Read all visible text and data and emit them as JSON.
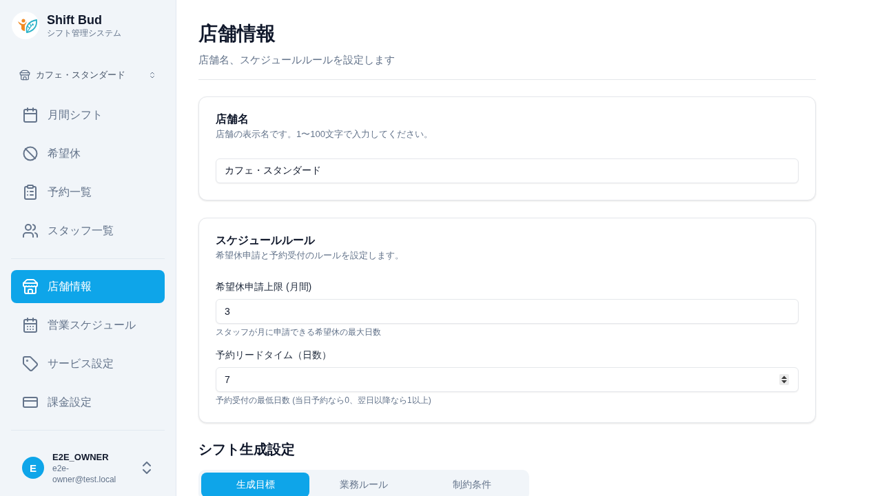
{
  "sidebar": {
    "brand": {
      "name": "Shift Bud",
      "subtitle": "シフト管理システム"
    },
    "store_selector": {
      "value": "カフェ・スタンダード"
    },
    "nav_groups": [
      {
        "items": [
          {
            "label": "月間シフト",
            "selected": false
          },
          {
            "label": "希望休",
            "selected": false
          },
          {
            "label": "予約一覧",
            "selected": false
          },
          {
            "label": "スタッフ一覧",
            "selected": false
          }
        ]
      },
      {
        "items": [
          {
            "label": "店舗情報",
            "selected": true
          },
          {
            "label": "営業スケジュール",
            "selected": false
          },
          {
            "label": "サービス設定",
            "selected": false
          },
          {
            "label": "課金設定",
            "selected": false
          }
        ]
      }
    ],
    "user": {
      "initial": "E",
      "name": "E2E_OWNER",
      "email": "e2e-owner@test.local"
    }
  },
  "page": {
    "title": "店舗情報",
    "subtitle": "店舗名、スケジュールルールを設定します"
  },
  "cards": [
    {
      "title": "店舗名",
      "description": "店舗の表示名です。1〜100文字で入力してください。",
      "fields": [
        {
          "value": "カフェ・スタンダード",
          "stepper": false
        }
      ]
    },
    {
      "title": "スケジュールルール",
      "description": "希望休申請と予約受付のルールを設定します。",
      "fields": [
        {
          "label": "希望休申請上限 (月間)",
          "value": "3",
          "help": "スタッフが月に申請できる希望休の最大日数",
          "stepper": false
        },
        {
          "label": "予約リードタイム（日数）",
          "value": "7",
          "help": "予約受付の最低日数 (当日予約なら0、翌日以降なら1以上)",
          "stepper": true
        }
      ]
    }
  ],
  "shift_settings": {
    "title": "シフト生成設定",
    "tabs": [
      {
        "label": "生成目標",
        "selected": true
      },
      {
        "label": "業務ルール",
        "selected": false
      },
      {
        "label": "制約条件",
        "selected": false
      }
    ]
  }
}
